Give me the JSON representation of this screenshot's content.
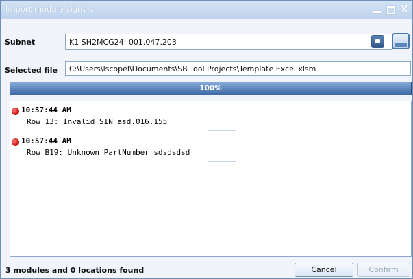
{
  "window": {
    "title": "Import module signals",
    "controls": {
      "minimize": "_",
      "maximize": "□",
      "close": "X"
    }
  },
  "subnet": {
    "label": "Subnet",
    "value": "K1 SH2MCG24: 001.047.203"
  },
  "selected_file": {
    "label": "Selected file",
    "value": "C:\\Users\\lscopel\\Documents\\SB Tool Projects\\Template Excel.xlsm"
  },
  "progress": {
    "label": "100%",
    "value": 1.0
  },
  "log": {
    "entries": [
      {
        "icon": "error-icon",
        "time": "10:57:44 AM",
        "message": "Row 13: Invalid SIN asd.016.155"
      },
      {
        "icon": "error-icon",
        "time": "10:57:44 AM",
        "message": "Row B19: Unknown PartNumber sdsdsdsd"
      }
    ]
  },
  "footer": {
    "status": "3 modules and 0 locations found",
    "cancel_label": "Cancel",
    "confirm_label": "Confirm"
  },
  "colors": {
    "accent": "#2f5588",
    "titlebar": "#c9dcf2",
    "error": "#d01515"
  }
}
